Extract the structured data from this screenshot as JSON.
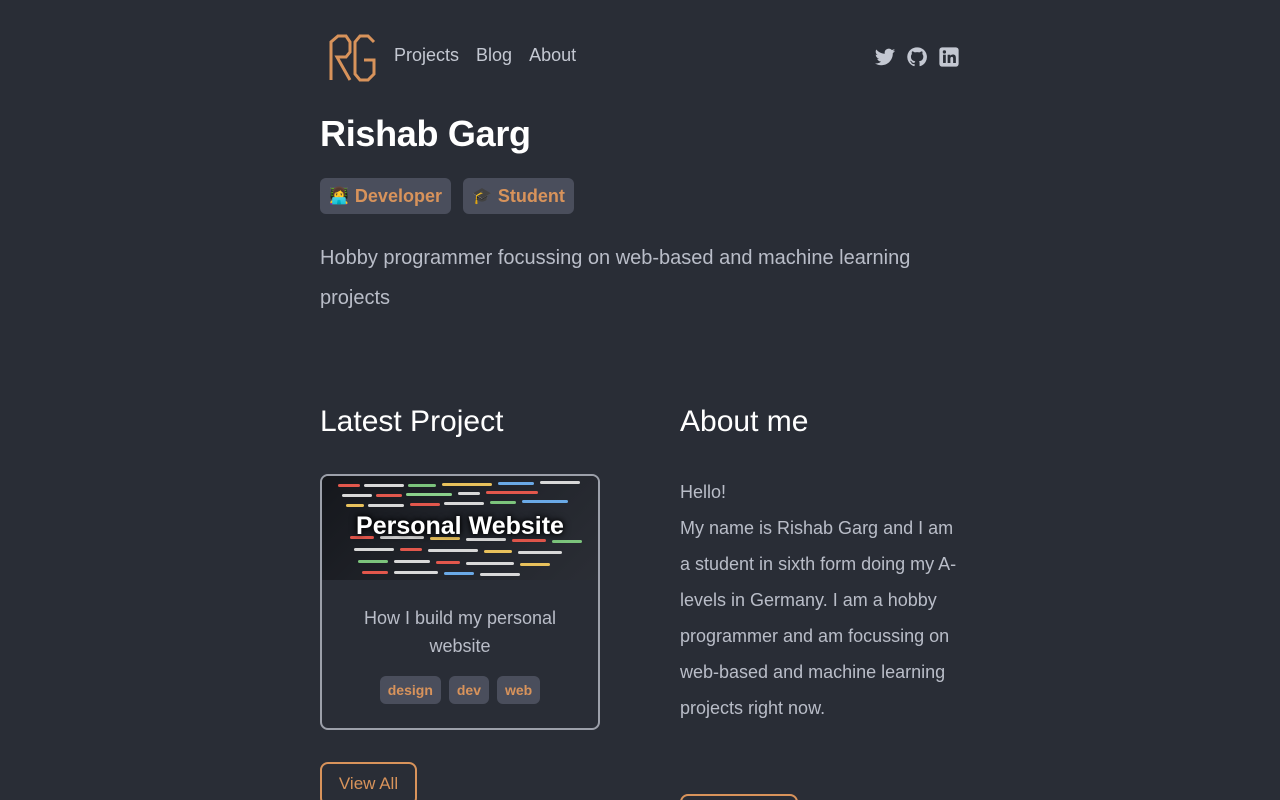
{
  "nav": {
    "logo_text": "RG",
    "links": [
      "Projects",
      "Blog",
      "About"
    ],
    "social_icons": [
      "twitter-icon",
      "github-icon",
      "linkedin-icon"
    ]
  },
  "hero": {
    "name": "Rishab Garg",
    "chips": [
      {
        "emoji": "👩‍💻",
        "label": "Developer"
      },
      {
        "emoji": "🎓",
        "label": "Student"
      }
    ],
    "description": "Hobby programmer focussing on web-based and machine learning projects"
  },
  "latest_project": {
    "heading": "Latest Project",
    "card": {
      "title": "Personal Website",
      "description": "How I build my personal website",
      "tags": [
        "design",
        "dev",
        "web"
      ]
    },
    "view_all_label": "View All"
  },
  "about": {
    "heading": "About me",
    "greeting": "Hello!",
    "body": "My name is Rishab Garg and I am a student in sixth form doing my A-levels in Germany. I am a hobby programmer and am focussing on web-based and machine learning projects right now."
  },
  "colors": {
    "background": "#292d36",
    "accent": "#d8935b",
    "chip_bg": "#4a4e5c",
    "text_muted": "#b9bdc8"
  }
}
